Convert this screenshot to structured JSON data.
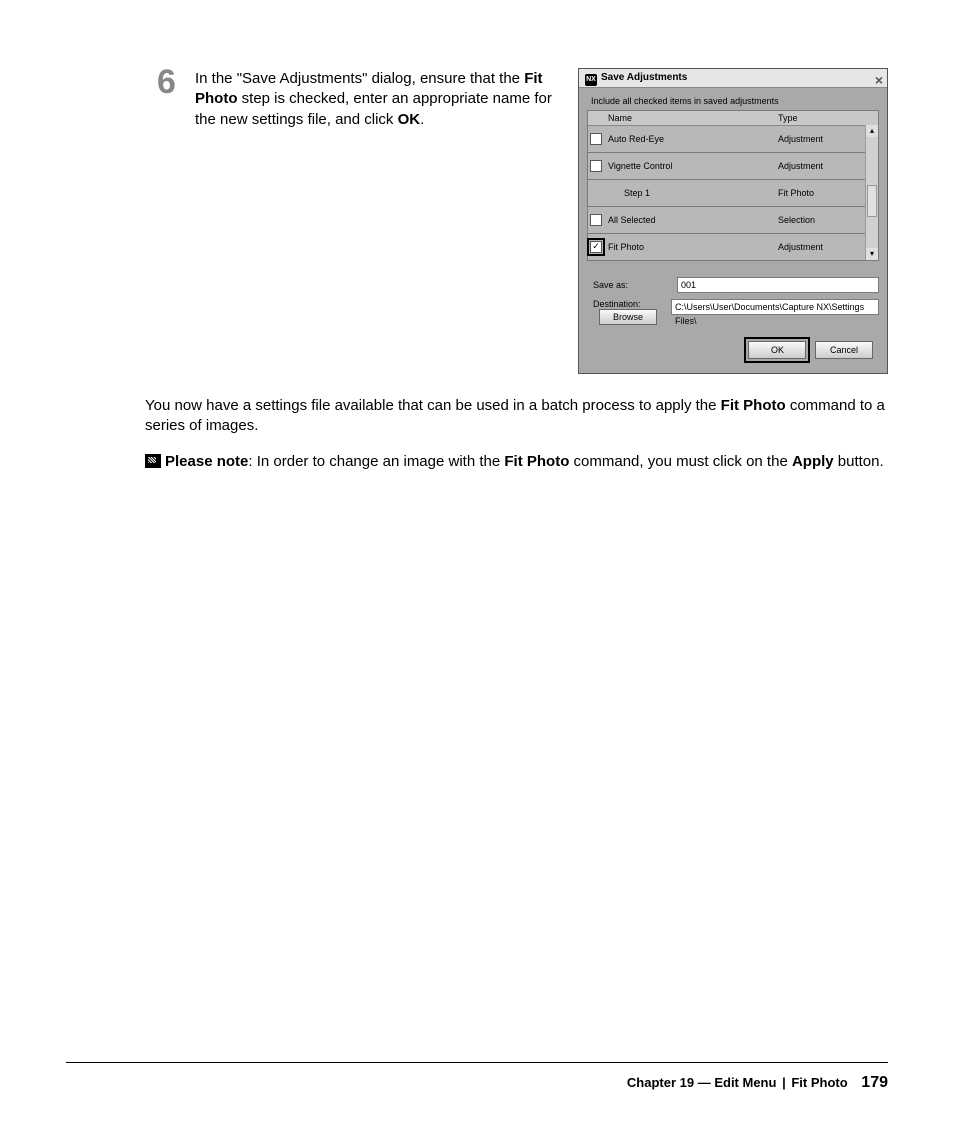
{
  "step": {
    "number": "6",
    "text_prefix": "In the \"Save Adjustments\" dialog, ensure that the ",
    "bold1": "Fit Photo",
    "text_mid1": " step is checked, enter an appropriate name for the new settings file, and click ",
    "bold2": "OK",
    "text_end": "."
  },
  "dialog": {
    "title": "Save Adjustments",
    "instruction": "Include all checked items in saved adjustments",
    "columns": {
      "name": "Name",
      "type": "Type"
    },
    "rows": [
      {
        "checked": false,
        "name": "Auto Red-Eye",
        "type": "Adjustment",
        "kind": "item"
      },
      {
        "checked": false,
        "name": "Vignette Control",
        "type": "Adjustment",
        "kind": "item"
      },
      {
        "name": "Step 1",
        "type": "Fit Photo",
        "kind": "step"
      },
      {
        "checked": false,
        "name": "All Selected",
        "type": "Selection",
        "kind": "item"
      },
      {
        "checked": true,
        "highlight": true,
        "name": "Fit Photo",
        "type": "Adjustment",
        "kind": "item"
      }
    ],
    "save_as_label": "Save as:",
    "save_as_value": "001",
    "destination_label": "Destination:",
    "browse_label": "Browse",
    "destination_value": "C:\\Users\\User\\Documents\\Capture NX\\Settings Files\\",
    "ok": "OK",
    "cancel": "Cancel"
  },
  "para1": {
    "t1": "You now have a settings file available that can be used in a batch process to apply the ",
    "b1": "Fit Photo",
    "t2": " command to a series of images."
  },
  "para2": {
    "b1": "Please note",
    "t1": ": In order to change an image with the ",
    "b2": "Fit Photo",
    "t2": " command, you must click on the ",
    "b3": "Apply",
    "t3": " button."
  },
  "footer": {
    "chapter": "Chapter 19 — Edit Menu",
    "section": "Fit Photo",
    "page": "179"
  }
}
